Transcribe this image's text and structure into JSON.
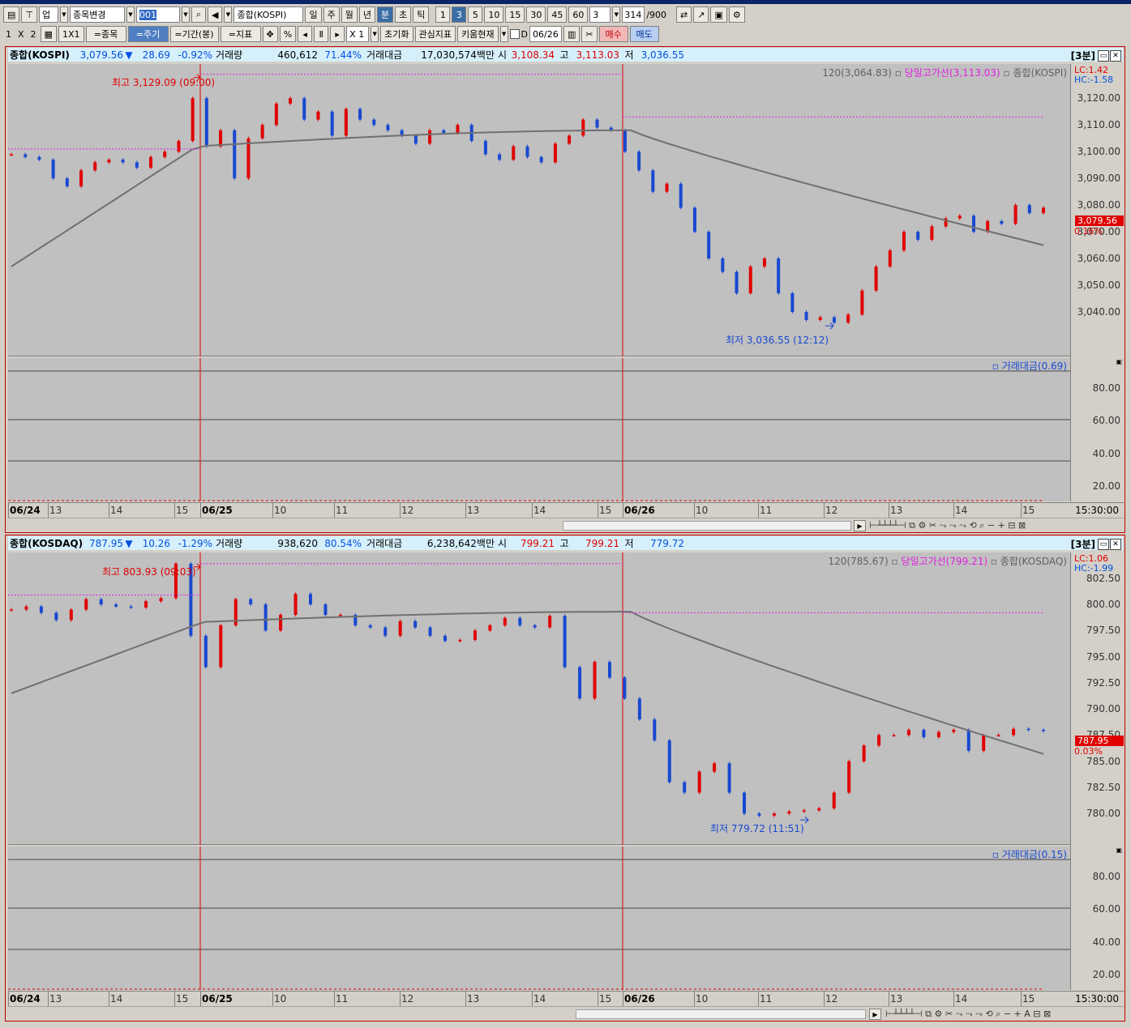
{
  "toolbar1": {
    "market": "업",
    "stock_change": "종목변경",
    "code": "001",
    "stock_name": "종합(KOSPI)",
    "periods": [
      "일",
      "주",
      "월",
      "년",
      "분",
      "초",
      "틱"
    ],
    "minutes": [
      "1",
      "3",
      "5",
      "10",
      "15",
      "30",
      "45",
      "60"
    ],
    "count": "3",
    "bars": "314",
    "bars_max": "/900"
  },
  "toolbar2": {
    "layout": [
      "1",
      "X",
      "2"
    ],
    "layout_1x1": "1X1",
    "btn_stock": "=종목",
    "btn_period": "=주기",
    "btn_range": "=기간(봉)",
    "btn_indicator": "=지표",
    "percent": "%",
    "mult": "X 1",
    "init": "초기화",
    "watch": "관심지표",
    "kiwoom": "키움현재",
    "d_label": "D",
    "date": "06/26",
    "buy": "매수",
    "sell": "매도"
  },
  "panels": [
    {
      "name": "종합(KOSPI)",
      "price": "3,079.56",
      "arrow": "▼",
      "change": "28.69",
      "pct": "-0.92%",
      "vol_label": "거래량",
      "vol": "460,612",
      "vol_pct": "71.44%",
      "amt_label": "거래대금",
      "amt": "17,030,574백만",
      "open_label": "시",
      "open": "3,108.34",
      "high_label": "고",
      "high": "3,113.03",
      "low_label": "저",
      "low": "3,036.55",
      "timeframe": "[3분]",
      "legend_ma": "120(3,064.83)",
      "legend_hl": "당일고가선(3,113.03)",
      "legend_name": "종합(KOSPI)",
      "lc": "LC:1.42",
      "hc": "HC:-1.58",
      "hi_note": "최고 3,129.09 (09:00)",
      "lo_note": "최저 3,036.55 (12:12)",
      "y_labels": [
        "3,120.00",
        "3,110.00",
        "3,100.00",
        "3,090.00",
        "3,080.00",
        "3,070.00",
        "3,060.00",
        "3,050.00",
        "3,040.00"
      ],
      "tag_price": "3,079.56",
      "tag_pct": "0.16%",
      "sub_legend": "거래대금(0.69)",
      "sub_labels": [
        "80.00",
        "60.00",
        "40.00",
        "20.00"
      ],
      "ymin": 3030,
      "ymax": 3131,
      "chart_data": {
        "type": "candlestick",
        "interval": "3분",
        "days": [
          "06/24",
          "06/25",
          "06/26"
        ],
        "ma120_start": 3057,
        "ma120_end": 3065,
        "points": [
          3099,
          3098,
          3097,
          3090,
          3087,
          3093,
          3096,
          3097,
          3096,
          3094,
          3098,
          3100,
          3104,
          3120,
          3102,
          3108,
          3090,
          3105,
          3110,
          3118,
          3120,
          3112,
          3115,
          3106,
          3116,
          3112,
          3110,
          3108,
          3106,
          3103,
          3108,
          3107,
          3110,
          3104,
          3099,
          3097,
          3102,
          3098,
          3096,
          3103,
          3106,
          3112,
          3109,
          3108,
          3100,
          3093,
          3085,
          3088,
          3079,
          3070,
          3060,
          3055,
          3047,
          3057,
          3060,
          3047,
          3040,
          3037,
          3038,
          3036,
          3039,
          3048,
          3057,
          3063,
          3070,
          3067,
          3072,
          3075,
          3076,
          3070,
          3074,
          3073,
          3080,
          3077,
          3079
        ]
      }
    },
    {
      "name": "종합(KOSDAQ)",
      "price": "787.95",
      "arrow": "▼",
      "change": "10.26",
      "pct": "-1.29%",
      "vol_label": "거래량",
      "vol": "938,620",
      "vol_pct": "80.54%",
      "amt_label": "거래대금",
      "amt": "6,238,642백만",
      "open_label": "시",
      "open": "799.21",
      "high_label": "고",
      "high": "799.21",
      "low_label": "저",
      "low": "779.72",
      "timeframe": "[3분]",
      "legend_ma": "120(785.67)",
      "legend_hl": "당일고가선(799.21)",
      "legend_name": "종합(KOSDAQ)",
      "lc": "LC:1.06",
      "hc": "HC:-1.99",
      "hi_note": "최고 803.93 (09:03)",
      "lo_note": "최저 779.72 (11:51)",
      "y_labels": [
        "802.50",
        "800.00",
        "797.50",
        "795.00",
        "792.50",
        "790.00",
        "787.50",
        "785.00",
        "782.50",
        "780.00"
      ],
      "tag_price": "787.95",
      "tag_pct": "0.03%",
      "sub_legend": "거래대금(0.15)",
      "sub_labels": [
        "80.00",
        "60.00",
        "40.00",
        "20.00"
      ],
      "ymin": 778.7,
      "ymax": 804.5,
      "chart_data": {
        "type": "candlestick",
        "interval": "3분",
        "days": [
          "06/24",
          "06/25",
          "06/26"
        ],
        "ma120_start": 791.5,
        "ma120_end": 785.7,
        "points": [
          799.5,
          799.8,
          799.2,
          798.5,
          799.5,
          800.5,
          800.0,
          799.8,
          799.7,
          800.3,
          800.6,
          803.9,
          797,
          794,
          798,
          800.5,
          800,
          797.5,
          799,
          801,
          800,
          799,
          799,
          798,
          797.8,
          797,
          798.4,
          797.8,
          797,
          796.5,
          796.6,
          797.5,
          798,
          798.7,
          798,
          797.8,
          798.9,
          794,
          791,
          794.5,
          793,
          791,
          789,
          787,
          783,
          782,
          784,
          784.8,
          782,
          780,
          779.8,
          780,
          780.2,
          780.3,
          780.5,
          782,
          785,
          786.5,
          787.5,
          787.5,
          788,
          787.3,
          787.8,
          788,
          786,
          787.5,
          787.5,
          788.1,
          788,
          787.9
        ]
      }
    }
  ],
  "x_labels": [
    {
      "t": "06/24",
      "b": true
    },
    {
      "t": "13"
    },
    {
      "t": "14"
    },
    {
      "t": "15"
    },
    {
      "t": "06/25",
      "b": true
    },
    {
      "t": "10"
    },
    {
      "t": "11"
    },
    {
      "t": "12"
    },
    {
      "t": "13"
    },
    {
      "t": "14"
    },
    {
      "t": "15"
    },
    {
      "t": "06/26",
      "b": true
    },
    {
      "t": "10"
    },
    {
      "t": "11"
    },
    {
      "t": "12"
    },
    {
      "t": "13"
    },
    {
      "t": "14"
    },
    {
      "t": "15"
    }
  ],
  "x_end": "15:30:00",
  "colors": {
    "up": "#e00000",
    "down": "#1848d0",
    "ma": "#707070",
    "highline": "#e020e0",
    "sep": "#e00000"
  }
}
